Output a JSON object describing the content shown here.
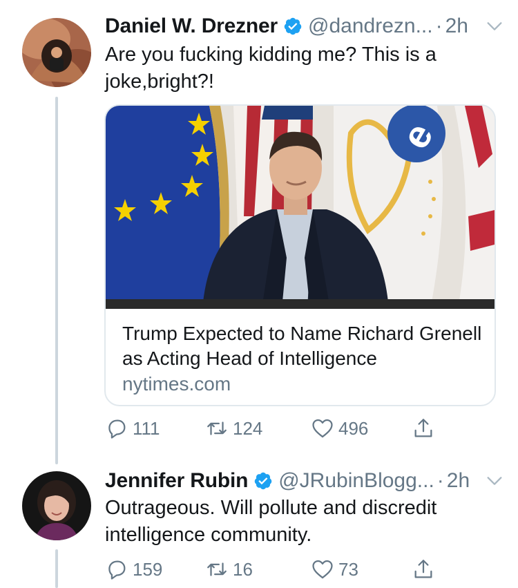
{
  "tweets": [
    {
      "name": "Daniel W. Drezner",
      "handle": "@dandrezn...",
      "separator": "·",
      "time": "2h",
      "text": "Are you fucking kidding me? This is a joke,bright?!",
      "card": {
        "title": "Trump Expected to Name Richard Grenell as Acting Head of Intelligence",
        "domain": "nytimes.com"
      },
      "replies": "111",
      "retweets": "124",
      "likes": "496"
    },
    {
      "name": "Jennifer Rubin",
      "handle": "@JRubinBlogg...",
      "separator": "·",
      "time": "2h",
      "text": "Outrageous. Will pollute and discredit intelligence community.",
      "replies": "159",
      "retweets": "16",
      "likes": "73"
    }
  ],
  "colors": {
    "verified": "#1da1f2",
    "secondary_text": "#657786",
    "thread_line": "#ccd6dd",
    "card_border": "#e1e8ed"
  },
  "icons": [
    "verified-badge-icon",
    "chevron-down-icon",
    "reply-icon",
    "retweet-icon",
    "like-icon",
    "share-icon"
  ]
}
